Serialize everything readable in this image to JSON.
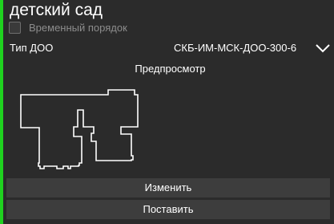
{
  "panel": {
    "title": "детский сад",
    "accent_color": "#1fd21f",
    "temporary_order": {
      "label": "Временный порядок",
      "checked": false
    },
    "type": {
      "label": "Тип ДОО",
      "selected_value": "СКБ-ИМ-МСК-ДОО-300-6",
      "dropdown_icon": "chevron-down-icon"
    },
    "preview": {
      "label": "Предпросмотр"
    },
    "buttons": {
      "edit_label": "Изменить",
      "place_label": "Поставить"
    }
  }
}
